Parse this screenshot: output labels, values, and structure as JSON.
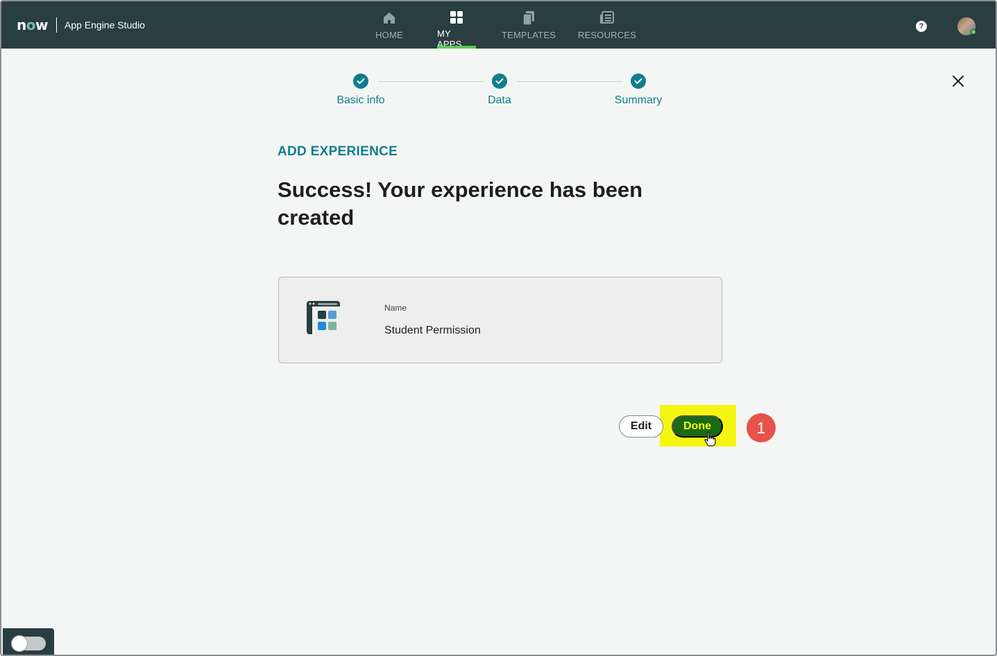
{
  "header": {
    "logo_text_n": "n",
    "logo_text_o": "o",
    "logo_text_w": "w",
    "app_title": "App Engine Studio",
    "help_glyph": "?",
    "nav": [
      {
        "label": "HOME",
        "icon": "home-icon",
        "active": false
      },
      {
        "label": "MY APPS",
        "icon": "grid-icon",
        "active": true
      },
      {
        "label": "TEMPLATES",
        "icon": "templates-icon",
        "active": false
      },
      {
        "label": "RESOURCES",
        "icon": "resources-icon",
        "active": false
      }
    ]
  },
  "stepper": {
    "steps": [
      {
        "label": "Basic info",
        "status": "complete"
      },
      {
        "label": "Data",
        "status": "complete"
      },
      {
        "label": "Summary",
        "status": "complete"
      }
    ]
  },
  "main": {
    "eyebrow": "ADD EXPERIENCE",
    "headline": "Success! Your experience has been created",
    "card": {
      "name_label": "Name",
      "name_value": "Student Permission"
    },
    "buttons": {
      "edit_label": "Edit",
      "done_label": "Done"
    },
    "annotation_badge": "1"
  },
  "colors": {
    "nav_bg": "#293e40",
    "accent_teal": "#0f7e8d",
    "done_bg": "#1a6b13",
    "highlight": "#f5f511",
    "badge": "#e8524a"
  }
}
